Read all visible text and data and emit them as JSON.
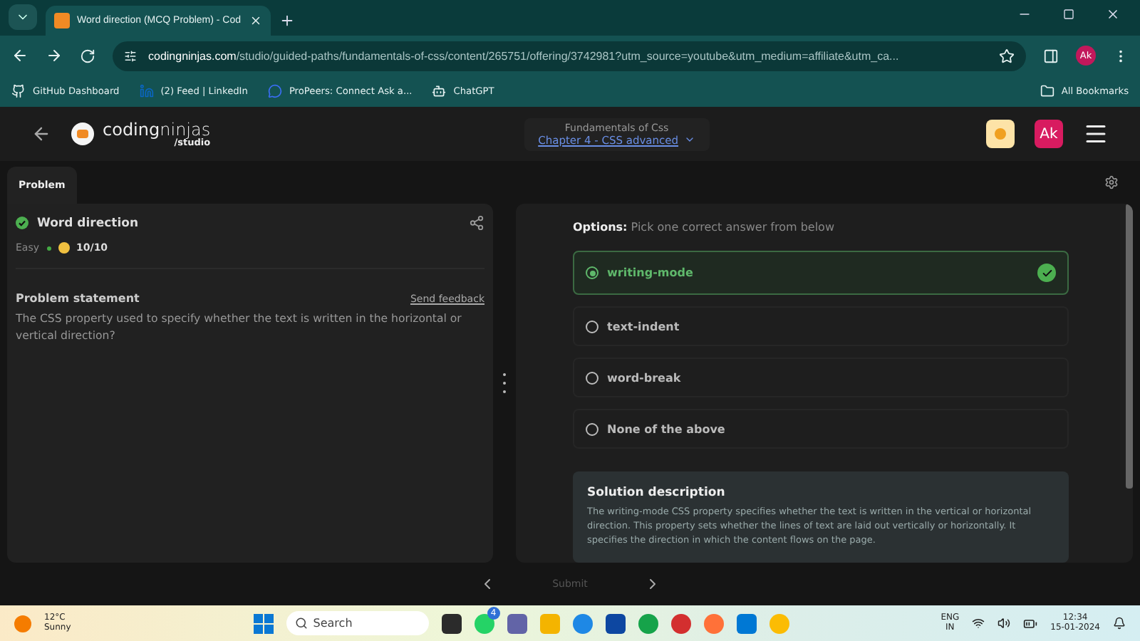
{
  "browser": {
    "tabs": [
      {
        "title": "Word direction (MCQ Problem) - Cod",
        "selected": true
      }
    ],
    "address": {
      "domain": "codingninjas.com",
      "path": "/studio/guided-paths/fundamentals-of-css/content/265751/offering/3742981?utm_source=youtube&utm_medium=affiliate&utm_ca..."
    },
    "profile": "Ak",
    "bookmarks": [
      {
        "label": "GitHub Dashboard",
        "kind": "github"
      },
      {
        "label": "(2) Feed | LinkedIn",
        "kind": "linkedin"
      },
      {
        "label": "ProPeers: Connect Ask a...",
        "kind": "chat"
      },
      {
        "label": "ChatGPT",
        "kind": "gpt"
      }
    ],
    "all_bookmarks": "All Bookmarks"
  },
  "header": {
    "logo": "**coding**ninjas",
    "logo_sub": "/studio",
    "course": "Fundamentals of Css",
    "chapter": "Chapter 4 - CSS advanced",
    "avatar": "Ak"
  },
  "tabs": [
    {
      "label": "Problem",
      "selected": true
    }
  ],
  "problem": {
    "solved": true,
    "title": "Word direction",
    "difficulty": "Easy",
    "score": "10/10",
    "statement_heading": "Problem statement",
    "send_feedback": "Send feedback",
    "statement": "The CSS property used to specify whether the text is written in the horizontal or vertical direction?"
  },
  "options_prompt": "**Options:** Pick one correct answer from below",
  "options": [
    {
      "label": "writing-mode",
      "selected": true,
      "correct": true
    },
    {
      "label": "text-indent",
      "selected": false,
      "correct": false
    },
    {
      "label": "word-break",
      "selected": false,
      "correct": false
    },
    {
      "label": "None of the above",
      "selected": false,
      "correct": false
    }
  ],
  "solution": {
    "heading": "Solution description",
    "text": "The writing-mode CSS property specifies whether the text is written in the vertical or horizontal direction. This property sets whether the lines of text are laid out vertically or horizontally. It specifies the direction in which the content flows on the page."
  },
  "footer": {
    "submit": "Submit",
    "submit_disabled": true
  },
  "taskbar": {
    "temperature": "12°C",
    "condition": "Sunny",
    "search_placeholder": "Search",
    "whatsapp_badge": "4",
    "language": "ENG",
    "region": "IN",
    "time": "12:34",
    "date": "15-01-2024"
  }
}
